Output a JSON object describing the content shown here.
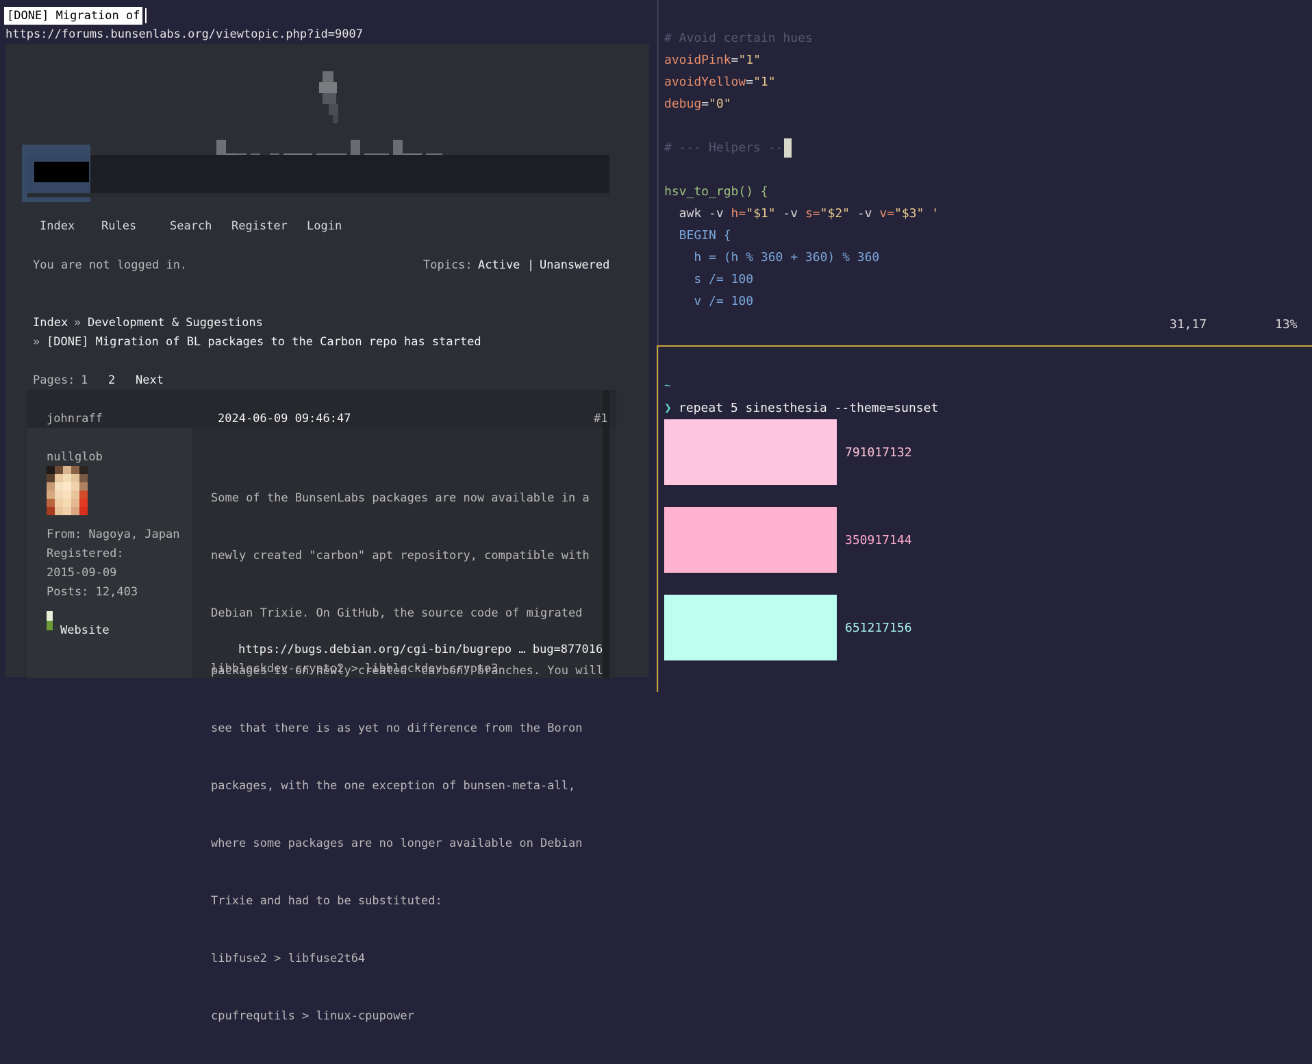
{
  "browser": {
    "tab_title": "[DONE] Migration of ",
    "url": "https://forums.bunsenlabs.org/viewtopic.php?id=9007",
    "nav": {
      "items": [
        "Index",
        "Rules",
        "Search",
        "Register",
        "Login"
      ]
    },
    "status": {
      "not_logged": "You are not logged in.",
      "topics_label": "Topics:",
      "active": "Active",
      "sep": "|",
      "unanswered": "Unanswered"
    },
    "breadcrumb": {
      "index": "Index",
      "sep1": "»",
      "section": "Development & Suggestions",
      "sep2": "»",
      "topic": "[DONE] Migration of BL packages to the Carbon repo has started"
    },
    "pagination": {
      "label": "Pages:",
      "page1": "1",
      "page2": "2",
      "next": "Next"
    },
    "post": {
      "author": "johnraff",
      "date": "2024-06-09 09:46:47",
      "number": "#1",
      "user_title": "nullglob",
      "from": "From: Nagoya, Japan",
      "registered_label": "Registered:",
      "registered_date": "2015-09-09",
      "posts": "Posts: 12,403",
      "website": "Website",
      "body_lines": [
        "Some of the BunsenLabs packages are now available in a",
        "newly created \"carbon\" apt repository, compatible with",
        "Debian Trixie. On GitHub, the source code of migrated",
        "packages is on newly created \"carbon\" branches. You will",
        "see that there is as yet no difference from the Boron",
        "packages, with the one exception of bunsen-meta-all,",
        "where some packages are no longer available on Debian",
        "Trixie and had to be substituted:",
        "libfuse2 > libfuse2t64",
        "cpufrequtils > linux-cpupower"
      ],
      "link": "https://bugs.debian.org/cgi-bin/bugrepo … bug=877016",
      "last_line": "libblockdev-crypto2 > libblockdev-crypto3"
    }
  },
  "editor": {
    "comment1": "# Avoid certain hues",
    "avoidPink_name": "avoidPink",
    "avoidPink_eq": "=",
    "avoidPink_val": "\"1\"",
    "avoidYellow_name": "avoidYellow",
    "avoidYellow_eq": "=",
    "avoidYellow_val": "\"1\"",
    "debug_name": "debug",
    "debug_eq": "=",
    "debug_val": "\"0\"",
    "comment2": "# --- Helpers --",
    "fn_decl": "hsv_to_rgb() {",
    "awk_line_a": "  awk -v ",
    "awk_h": "h=",
    "awk_h_val": "\"$1\"",
    "awk_mid1": " -v ",
    "awk_s": "s=",
    "awk_s_val": "\"$2\"",
    "awk_mid2": " -v ",
    "awk_v": "v=",
    "awk_v_val": "\"$3\"",
    "awk_quote": " '",
    "begin": "  BEGIN {",
    "line_h": "    h = (h % 360 + 360) % 360",
    "line_s": "    s /= 100",
    "line_v": "    v /= 100",
    "position": "31,17",
    "percent": "13%"
  },
  "terminal": {
    "cwd": "~",
    "prompt": "❯",
    "command": "repeat 5 sinesthesia --theme=sunset",
    "swatches": [
      {
        "color": "#ffc6e0",
        "label": "791017132",
        "label_color": "#ffc2d8"
      },
      {
        "color": "#ffb3d0",
        "label": "350917144",
        "label_color": "#ffaacb"
      },
      {
        "color": "#bcfff1",
        "label": "651217156",
        "label_color": "#a8f5e8"
      }
    ]
  }
}
